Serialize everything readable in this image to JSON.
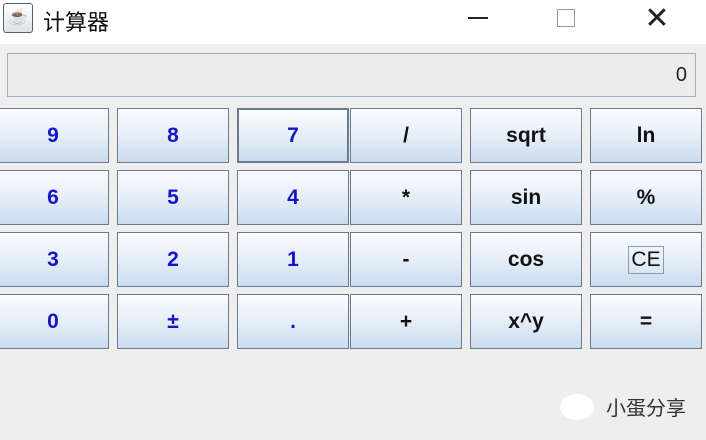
{
  "window": {
    "title": "计算器",
    "icon": "java-cup-icon"
  },
  "display": {
    "value": "0"
  },
  "buttons": [
    [
      "9",
      "8",
      "7",
      "/",
      "sqrt",
      "ln"
    ],
    [
      "6",
      "5",
      "4",
      "*",
      "sin",
      "%"
    ],
    [
      "3",
      "2",
      "1",
      "-",
      "cos",
      "CE"
    ],
    [
      "0",
      "±",
      ".",
      "+",
      "x^y",
      "="
    ]
  ],
  "colors": {
    "number": "#1414c8",
    "operator": "#111111"
  },
  "watermark": {
    "text": "小蛋分享",
    "icon": "wechat-icon"
  }
}
